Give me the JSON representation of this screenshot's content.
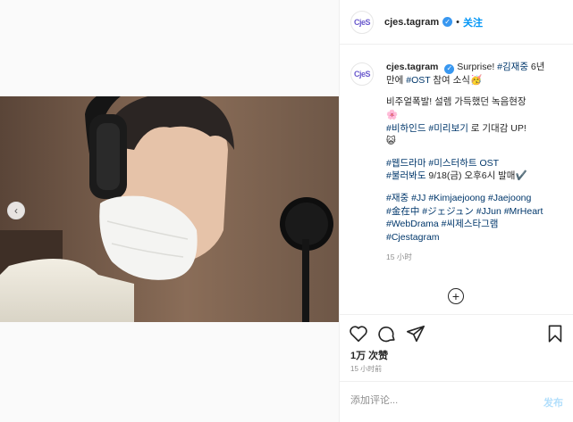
{
  "account": {
    "avatar_text": "CjeS",
    "username": "cjes.tagram",
    "verified_mark": "✓",
    "separator": "•",
    "follow_label": "关注"
  },
  "media": {
    "prev_icon": "‹"
  },
  "caption": {
    "username": "cjes.tagram",
    "lines": [
      [
        {
          "t": "Surprise! "
        },
        {
          "t": "#김재중",
          "tag": true
        },
        {
          "t": " 6년"
        }
      ],
      [
        {
          "t": "만에 "
        },
        {
          "t": "#OST",
          "tag": true
        },
        {
          "t": " 참여 소식🥳"
        }
      ]
    ],
    "line3": "비주얼폭발! 설렘 가득했던 녹음현장",
    "line4": "🌸",
    "line5a": "#비하인드",
    "line5b": " ",
    "line5c": "#미리보기",
    "line5d": " 로 기대감 UP!",
    "line6": "😺",
    "line7": "#웹드라마 #미스터하트 OST",
    "line8a": "#불러봐도",
    "line8b": " 9/18(금) 오후6시 발매✔️",
    "tags1": "#재중 #JJ #Kimjaejoong #Jaejoong",
    "tags2": "#金在中 #ジェジュン #JJun #MrHeart",
    "tags3": "#WebDrama #씨제스타그램",
    "tags4": "#Cjestagram",
    "time": "15 小时"
  },
  "load_more_icon": "+",
  "icons": {
    "like": "heart-icon",
    "comment": "comment-icon",
    "share": "share-icon",
    "save": "bookmark-icon"
  },
  "stats": {
    "likes": "1万 次赞",
    "posted": "15 小时前"
  },
  "comment": {
    "placeholder": "添加评论...",
    "post_label": "发布"
  },
  "colors": {
    "link": "#0095f6",
    "hashtag": "#00376b",
    "muted": "#8e8e8e",
    "post_disabled": "#b2dffc"
  }
}
